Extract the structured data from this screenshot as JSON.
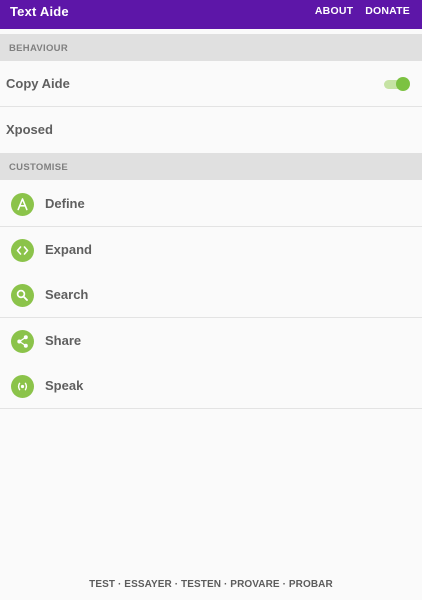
{
  "app_bar": {
    "title": "Text Aide",
    "actions": [
      "ABOUT",
      "DONATE"
    ]
  },
  "behaviour": {
    "header": "BEHAVIOUR",
    "copy_aide": {
      "label": "Copy Aide",
      "enabled": true
    },
    "xposed": {
      "label": "Xposed"
    }
  },
  "customise": {
    "header": "CUSTOMISE",
    "items": [
      {
        "label": "Define",
        "icon": "define-letter-a-icon"
      },
      {
        "label": "Expand",
        "icon": "expand-code-icon"
      },
      {
        "label": "Search",
        "icon": "search-icon"
      },
      {
        "label": "Share",
        "icon": "share-icon"
      },
      {
        "label": "Speak",
        "icon": "speak-icon"
      }
    ]
  },
  "footer": {
    "text": "TEST · ESSAYER · TESTEN · PROVARE · PROBAR"
  },
  "colors": {
    "app_bar": "#5d16a8",
    "accent": "#8bc34a",
    "section_header_bg": "#e0e0e0"
  }
}
